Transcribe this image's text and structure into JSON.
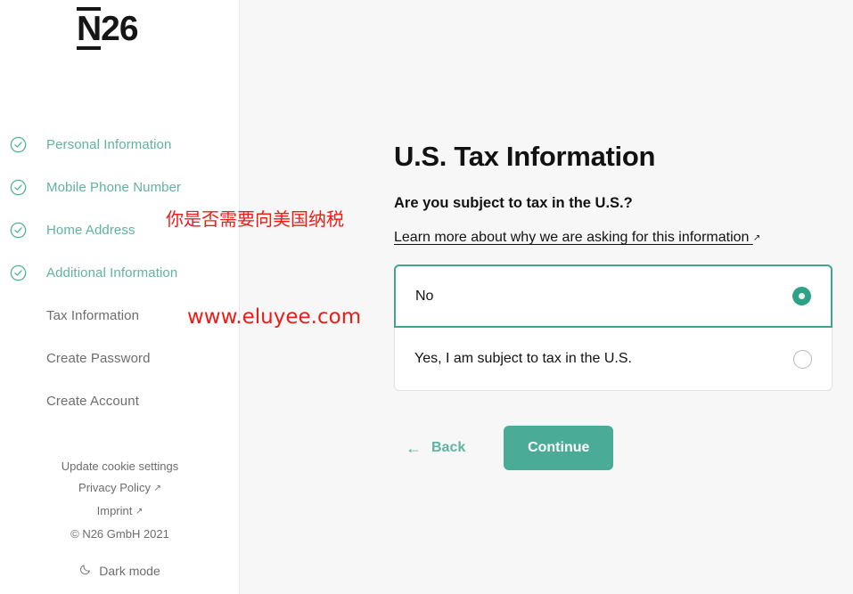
{
  "brand": {
    "logo_text": "N",
    "logo_suffix": "26"
  },
  "sidebar": {
    "steps": [
      {
        "label": "Personal Information",
        "state": "done",
        "icon": "check-circle-icon"
      },
      {
        "label": "Mobile Phone Number",
        "state": "done",
        "icon": "check-circle-icon"
      },
      {
        "label": "Home Address",
        "state": "done",
        "icon": "check-circle-icon"
      },
      {
        "label": "Additional Information",
        "state": "done",
        "icon": "check-circle-icon"
      },
      {
        "label": "Tax Information",
        "state": "todo",
        "icon": ""
      },
      {
        "label": "Create Password",
        "state": "todo",
        "icon": ""
      },
      {
        "label": "Create Account",
        "state": "todo",
        "icon": ""
      }
    ],
    "footer": {
      "cookie_settings": "Update cookie settings",
      "privacy_policy": "Privacy Policy",
      "imprint": "Imprint",
      "copyright": "© N26 GmbH 2021",
      "external_arrow": "↗"
    },
    "dark_mode": {
      "label": "Dark mode",
      "icon": "moon-icon"
    }
  },
  "main": {
    "title": "U.S. Tax Information",
    "question": "Are you subject to tax in the U.S.?",
    "learn_more": "Learn more about why we are asking for this information",
    "learn_more_arrow": "↗",
    "options": [
      {
        "label": "No",
        "selected": true
      },
      {
        "label": "Yes, I am subject to tax in the U.S.",
        "selected": false
      }
    ],
    "back_label": "Back",
    "back_arrow": "←",
    "continue_label": "Continue"
  },
  "annotations": {
    "chinese_note": "你是否需要向美国纳税",
    "watermark": "www.eluyee.com"
  },
  "colors": {
    "accent_green": "#4aab97",
    "radio_green": "#2ea287",
    "step_done_text": "#5fb3a1",
    "annotation_red": "#ee1b17",
    "page_bg": "#f7f7f7",
    "sidebar_bg": "#ffffff"
  }
}
